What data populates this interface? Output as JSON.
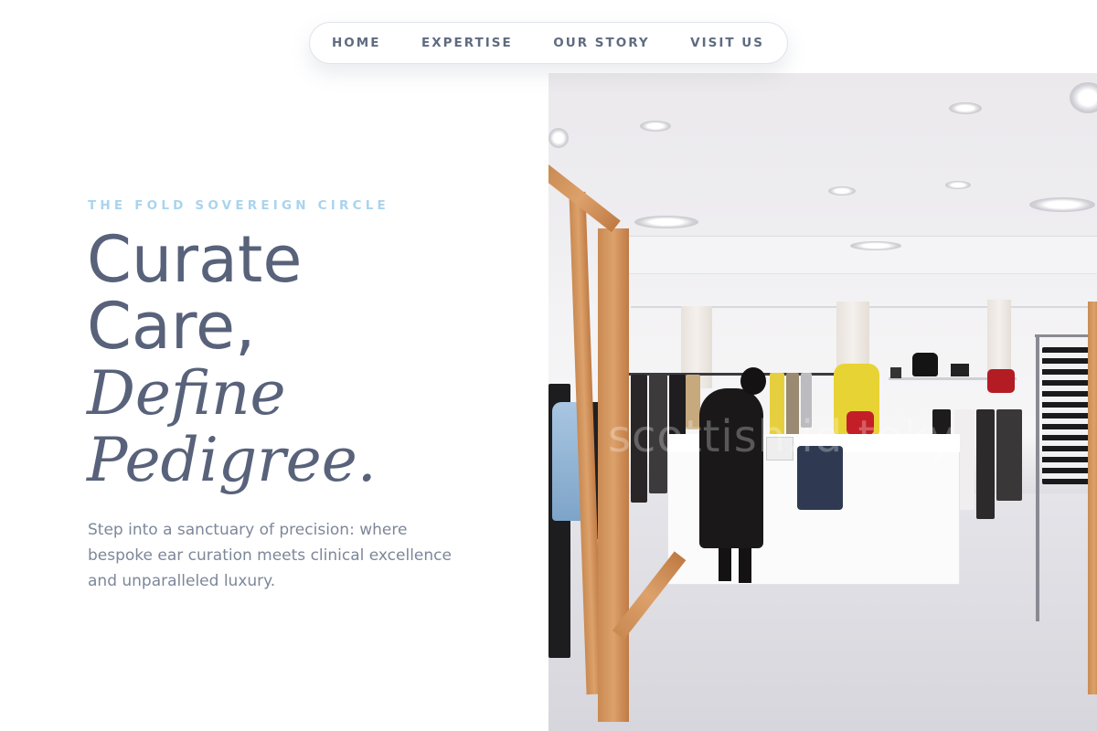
{
  "nav": {
    "items": [
      "HOME",
      "EXPERTISE",
      "OUR STORY",
      "VISIT US"
    ]
  },
  "hero": {
    "eyebrow": "THE FOLD SOVEREIGN CIRCLE",
    "headline_line1": "Curate",
    "headline_line2": "Care,",
    "headline_line3": "Define",
    "headline_line4": "Pedigree.",
    "lede": "Step into a sanctuary of precision: where bespoke ear curation meets clinical excellence and unparalleled luxury."
  },
  "image": {
    "subject": "boutique-interior-photo",
    "watermark": "scottish.id.toky"
  },
  "colors": {
    "text_primary": "#58627a",
    "text_muted": "#7d879a",
    "accent": "#a9d4ee",
    "nav_text": "#5f6b80"
  }
}
